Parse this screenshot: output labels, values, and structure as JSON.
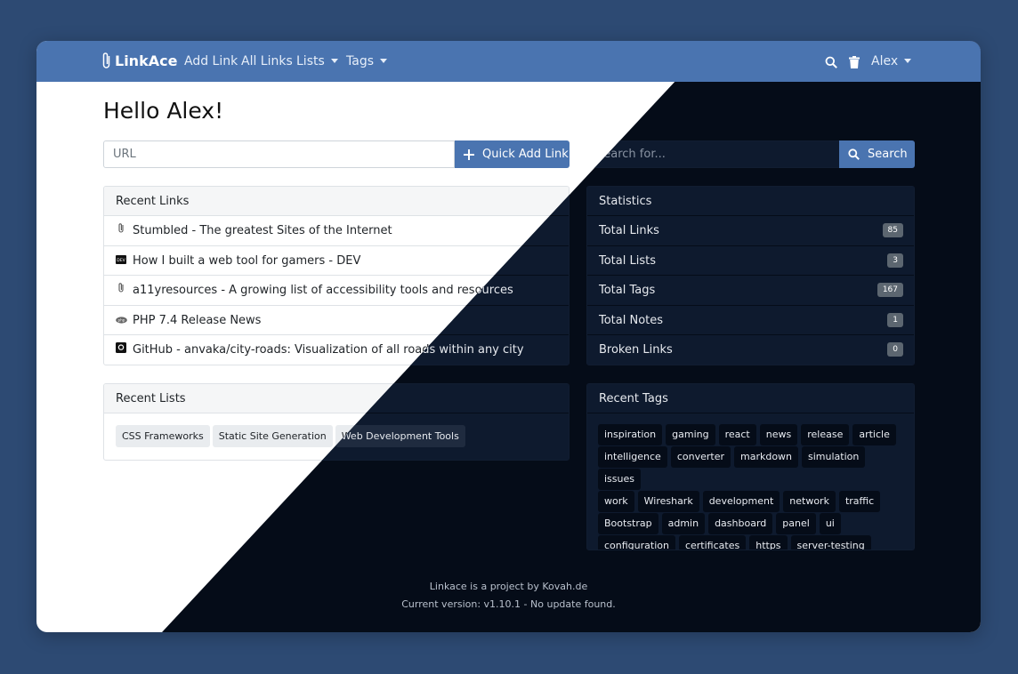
{
  "nav": {
    "brand": "LinkAce",
    "add_link": "Add Link",
    "all_links": "All Links",
    "lists": "Lists",
    "tags": "Tags",
    "user": "Alex",
    "icons": [
      "paperclip-icon",
      "search-icon",
      "trash-icon",
      "caret-down-icon"
    ]
  },
  "greeting": "Hello Alex!",
  "quick_add": {
    "placeholder": "URL",
    "button": "Quick Add Link"
  },
  "search": {
    "placeholder": "Search for...",
    "button": "Search"
  },
  "recent_links": {
    "title": "Recent Links",
    "items": [
      {
        "title": "Stumbled - The greatest Sites of the Internet",
        "icon": "paperclip-icon"
      },
      {
        "title": "How I built a web tool for gamers - DEV",
        "icon": "dev-icon"
      },
      {
        "title": "a11yresources - A growing list of accessibility tools and resources",
        "icon": "paperclip-icon"
      },
      {
        "title": "PHP 7.4 Release News",
        "icon": "php-icon"
      },
      {
        "title": "GitHub - anvaka/city-roads: Visualization of all roads within any city",
        "icon": "github-icon"
      }
    ]
  },
  "statistics": {
    "title": "Statistics",
    "items": [
      {
        "label": "Total Links",
        "value": "85"
      },
      {
        "label": "Total Lists",
        "value": "3"
      },
      {
        "label": "Total Tags",
        "value": "167"
      },
      {
        "label": "Total Notes",
        "value": "1"
      },
      {
        "label": "Broken Links",
        "value": "0"
      }
    ]
  },
  "recent_lists": {
    "title": "Recent Lists",
    "items": [
      "CSS Frameworks",
      "Static Site Generation",
      "Web Development Tools"
    ]
  },
  "recent_tags": {
    "title": "Recent Tags",
    "rows": [
      [
        "inspiration",
        "gaming",
        "react",
        "news",
        "release",
        "article"
      ],
      [
        "intelligence",
        "converter",
        "markdown",
        "simulation",
        "issues"
      ],
      [
        "work",
        "Wireshark",
        "development",
        "network",
        "traffic"
      ],
      [
        "Bootstrap",
        "admin",
        "dashboard",
        "panel",
        "ui"
      ],
      [
        "configuration",
        "certificates",
        "https",
        "server-testing"
      ]
    ]
  },
  "footer": {
    "line1": "Linkace is a project by Kovah.de",
    "line2": "Current version: v1.10.1 - No update found."
  },
  "colors": {
    "background": "#2d4a73",
    "navbar": "#4a74b0",
    "dark_bg": "#050c18",
    "dark_card": "#0e1a2e"
  }
}
